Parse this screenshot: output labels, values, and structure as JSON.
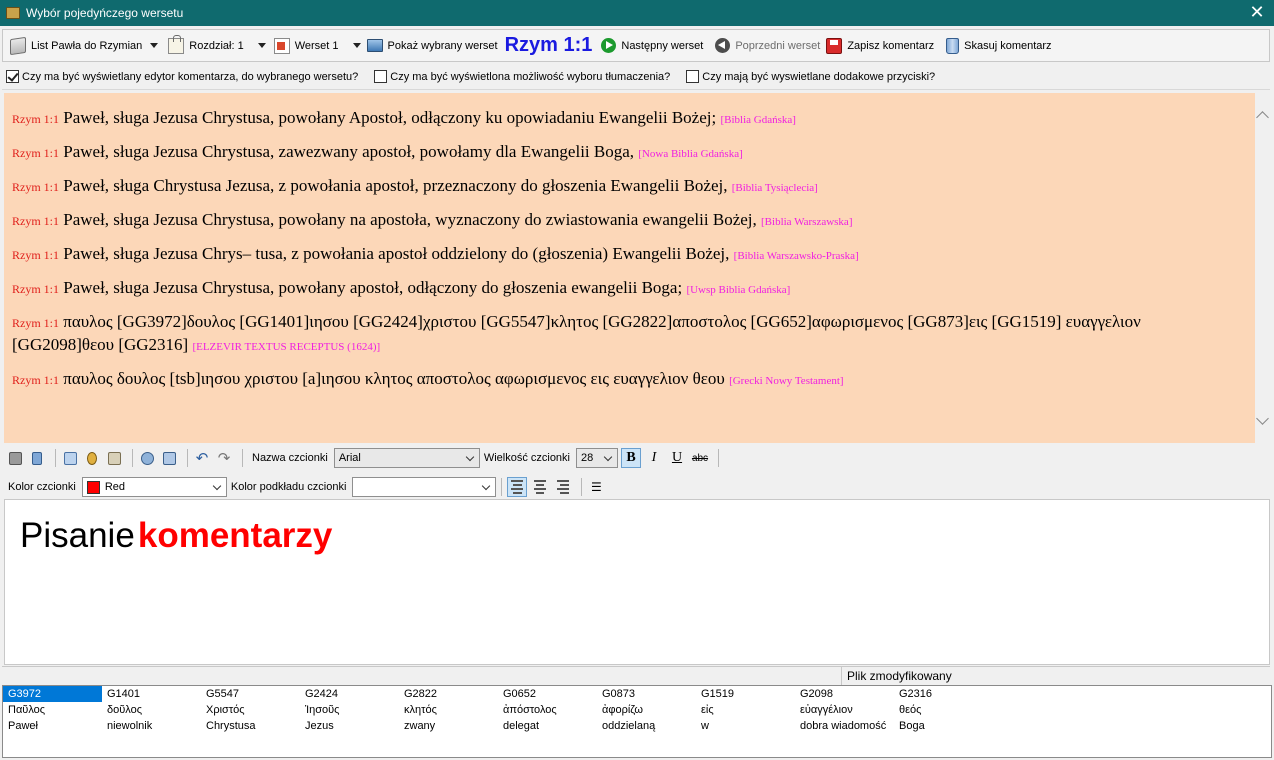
{
  "window": {
    "title": "Wybór pojedyńczego wersetu"
  },
  "toolbar": {
    "book": "List Pawła do Rzymian",
    "chapter": "Rozdział: 1",
    "verse": "Werset 1",
    "show": "Pokaż wybrany werset",
    "current": "Rzym 1:1",
    "next": "Następny werset",
    "prev": "Poprzedni werset",
    "save": "Zapisz komentarz",
    "delete": "Skasuj komentarz"
  },
  "options": [
    {
      "label": "Czy ma być wyświetlany edytor komentarza, do wybranego wersetu?",
      "checked": true
    },
    {
      "label": "Czy ma być wyświetlona możliwość wyboru tłumaczenia?",
      "checked": false
    },
    {
      "label": "Czy mają być wyswietlane dodakowe przyciski?",
      "checked": false
    }
  ],
  "verses": [
    {
      "ref": "Rzym 1:1",
      "text": "Paweł, sługa Jezusa Chrystusa, powołany Apostoł, odłączony ku opowiadaniu Ewangelii Bożej;",
      "tr": "[Biblia Gdańska]"
    },
    {
      "ref": "Rzym 1:1",
      "text": "Paweł, sługa Jezusa Chrystusa, zawezwany apostoł, powołamy dla Ewangelii Boga,",
      "tr": "[Nowa Biblia Gdańska]"
    },
    {
      "ref": "Rzym 1:1",
      "text": "Paweł, sługa Chrystusa Jezusa, z powołania apostoł, przeznaczony do głoszenia Ewangelii Bożej,",
      "tr": "[Biblia Tysiąclecia]"
    },
    {
      "ref": "Rzym 1:1",
      "text": "Paweł, sługa Jezusa Chrystusa, powołany na apostoła, wyznaczony do zwiastowania ewangelii Bożej,",
      "tr": "[Biblia Warszawska]"
    },
    {
      "ref": "Rzym 1:1",
      "text": "Paweł, sługa Jezusa Chrys– tusa, z powołania apostoł oddzielony do (głoszenia) Ewangelii Bożej,",
      "tr": "[Biblia Warszawsko-Praska]"
    },
    {
      "ref": "Rzym 1:1",
      "text": "Paweł, sługa Jezusa Chrystusa, powołany apostoł, odłączony do głoszenia ewangelii Boga;",
      "tr": "[Uwsp Biblia Gdańska]"
    },
    {
      "ref": "Rzym 1:1",
      "text": "παυλος [GG3972]δουλος [GG1401]ιησου [GG2424]χριστου [GG5547]κλητος [GG2822]αποστολος [GG652]αφωρισμενος [GG873]εις [GG1519] ευαγγελιον [GG2098]θεου [GG2316]",
      "tr": "[ELZEVIR TEXTUS RECEPTUS (1624)]"
    },
    {
      "ref": "Rzym 1:1",
      "text": "παυλος δουλος [tsb]ιησου χριστου [a]ιησου κλητος αποστολος αφωρισμενος εις ευαγγελιον θεου",
      "tr": "[Grecki Nowy Testament]"
    }
  ],
  "editor_tools": {
    "font_name_label": "Nazwa czcionki",
    "font_name": "Arial",
    "font_size_label": "Wielkość czcionki",
    "font_size": "28",
    "bold": "B",
    "italic": "I",
    "underline": "U",
    "strike": "abc",
    "font_color_label": "Kolor czcionki",
    "font_color": "Red",
    "bg_color_label": "Kolor podkładu czcionki",
    "bg_color": ""
  },
  "editor": {
    "word1": "Pisanie",
    "word2": "komentarzy"
  },
  "status": {
    "text": "Plik zmodyfikowany"
  },
  "lexicon": [
    {
      "code": "G3972",
      "greek": "Παῦλος",
      "pl": "Paweł"
    },
    {
      "code": "G1401",
      "greek": "δοῦλος",
      "pl": "niewolnik"
    },
    {
      "code": "G5547",
      "greek": "Χριστός",
      "pl": "Chrystusa"
    },
    {
      "code": "G2424",
      "greek": "Ἰησοῦς",
      "pl": "Jezus"
    },
    {
      "code": "G2822",
      "greek": "κλητός",
      "pl": "zwany"
    },
    {
      "code": "G0652",
      "greek": "ἀπόστολος",
      "pl": "delegat"
    },
    {
      "code": "G0873",
      "greek": "ἀφορίζω",
      "pl": "oddzielaną"
    },
    {
      "code": "G1519",
      "greek": "εἰς",
      "pl": "w"
    },
    {
      "code": "G2098",
      "greek": "εὐαγγέλιον",
      "pl": "dobra wiadomość"
    },
    {
      "code": "G2316",
      "greek": "θεός",
      "pl": "Boga"
    }
  ]
}
